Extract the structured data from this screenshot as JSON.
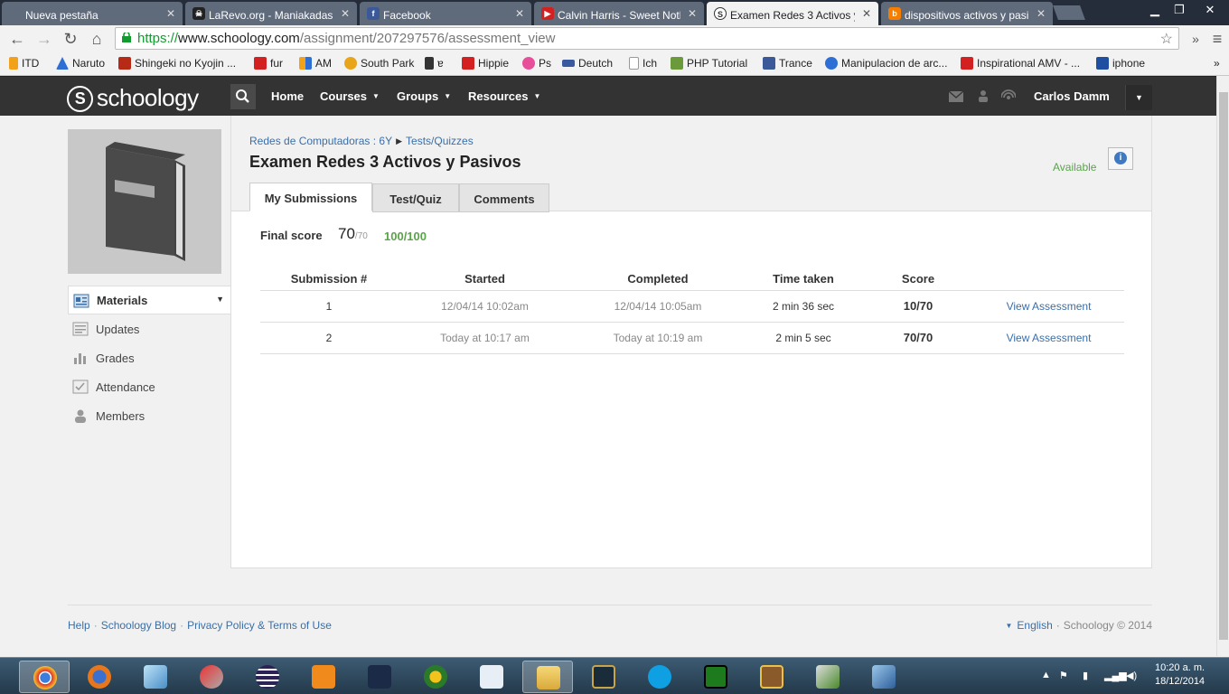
{
  "browser": {
    "tabs": [
      {
        "label": "Nueva pestaña",
        "active": false
      },
      {
        "label": "LaRevo.org - Maniakadas",
        "active": false
      },
      {
        "label": "Facebook",
        "active": false
      },
      {
        "label": "Calvin Harris - Sweet Noth",
        "active": false
      },
      {
        "label": "Examen Redes 3 Activos y",
        "active": true
      },
      {
        "label": "dispositivos activos y pasi",
        "active": false
      }
    ],
    "url_protocol": "https://",
    "url_host": "www.schoology.com",
    "url_path": "/assignment/207297576/assessment_view",
    "bookmarks": [
      "ITD",
      "Naruto",
      "Shingeki no Kyojin ...",
      "fur",
      "AM",
      "South Park",
      "ɐ",
      "Hippie",
      "Ps",
      "Deutch",
      "Ich",
      "PHP Tutorial",
      "Trance",
      "Manipulacion de arc...",
      "Inspirational AMV - ...",
      "iphone"
    ],
    "more_bookmarks": "»"
  },
  "header": {
    "logo": "schoology",
    "nav": [
      "Home",
      "Courses",
      "Groups",
      "Resources"
    ],
    "user": "Carlos Damm"
  },
  "sidebar": {
    "items": [
      "Materials",
      "Updates",
      "Grades",
      "Attendance",
      "Members"
    ]
  },
  "main": {
    "breadcrumb": [
      "Redes de Computadoras : 6Y",
      "Tests/Quizzes"
    ],
    "title": "Examen Redes 3 Activos y Pasivos",
    "status": "Available",
    "tabs": [
      "My Submissions",
      "Test/Quiz",
      "Comments"
    ],
    "final_score_label": "Final score",
    "final_score": "70",
    "final_score_max": "/70",
    "final_score_pct": "100/100",
    "table": {
      "headers": [
        "Submission #",
        "Started",
        "Completed",
        "Time taken",
        "Score",
        ""
      ],
      "rows": [
        [
          "1",
          "12/04/14 10:02am",
          "12/04/14 10:05am",
          "2 min 36 sec",
          "10/70",
          "View Assessment"
        ],
        [
          "2",
          "Today at 10:17 am",
          "Today at 10:19 am",
          "2 min 5 sec",
          "70/70",
          "View Assessment"
        ]
      ]
    }
  },
  "footer": {
    "links": [
      "Help",
      "Schoology Blog",
      "Privacy Policy & Terms of Use"
    ],
    "language": "English",
    "copyright": "Schoology © 2014"
  },
  "taskbar": {
    "time": "10:20 a. m.",
    "date": "18/12/2014"
  },
  "colors": {
    "header_bg": "#333333",
    "link": "#3a6fa8",
    "success_green": "#5aa34a",
    "taskbar": "#2f4a60"
  }
}
